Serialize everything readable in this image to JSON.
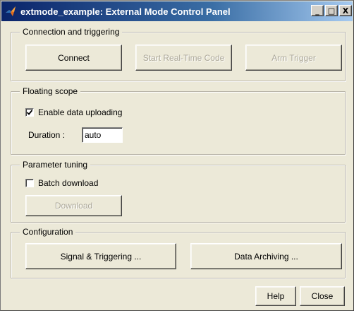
{
  "window": {
    "title": "extmode_example: External Mode Control Panel",
    "minimize_label": "_",
    "maximize_label": "□",
    "close_label": "X"
  },
  "connection": {
    "legend": "Connection and triggering",
    "connect_label": "Connect",
    "start_label": "Start Real-Time Code",
    "arm_label": "Arm Trigger"
  },
  "floating_scope": {
    "legend": "Floating scope",
    "enable_upload_label": "Enable data uploading",
    "enable_upload_checked": true,
    "duration_label": "Duration :",
    "duration_value": "auto"
  },
  "parameter_tuning": {
    "legend": "Parameter tuning",
    "batch_download_label": "Batch download",
    "batch_download_checked": false,
    "download_label": "Download"
  },
  "configuration": {
    "legend": "Configuration",
    "signal_label": "Signal & Triggering ...",
    "archiving_label": "Data Archiving ..."
  },
  "footer": {
    "help_label": "Help",
    "close_label": "Close"
  },
  "colors": {
    "titlebar_start": "#0a246a",
    "titlebar_end": "#a6caf0",
    "window_bg": "#ece9d8",
    "disabled_text": "#aca899"
  }
}
